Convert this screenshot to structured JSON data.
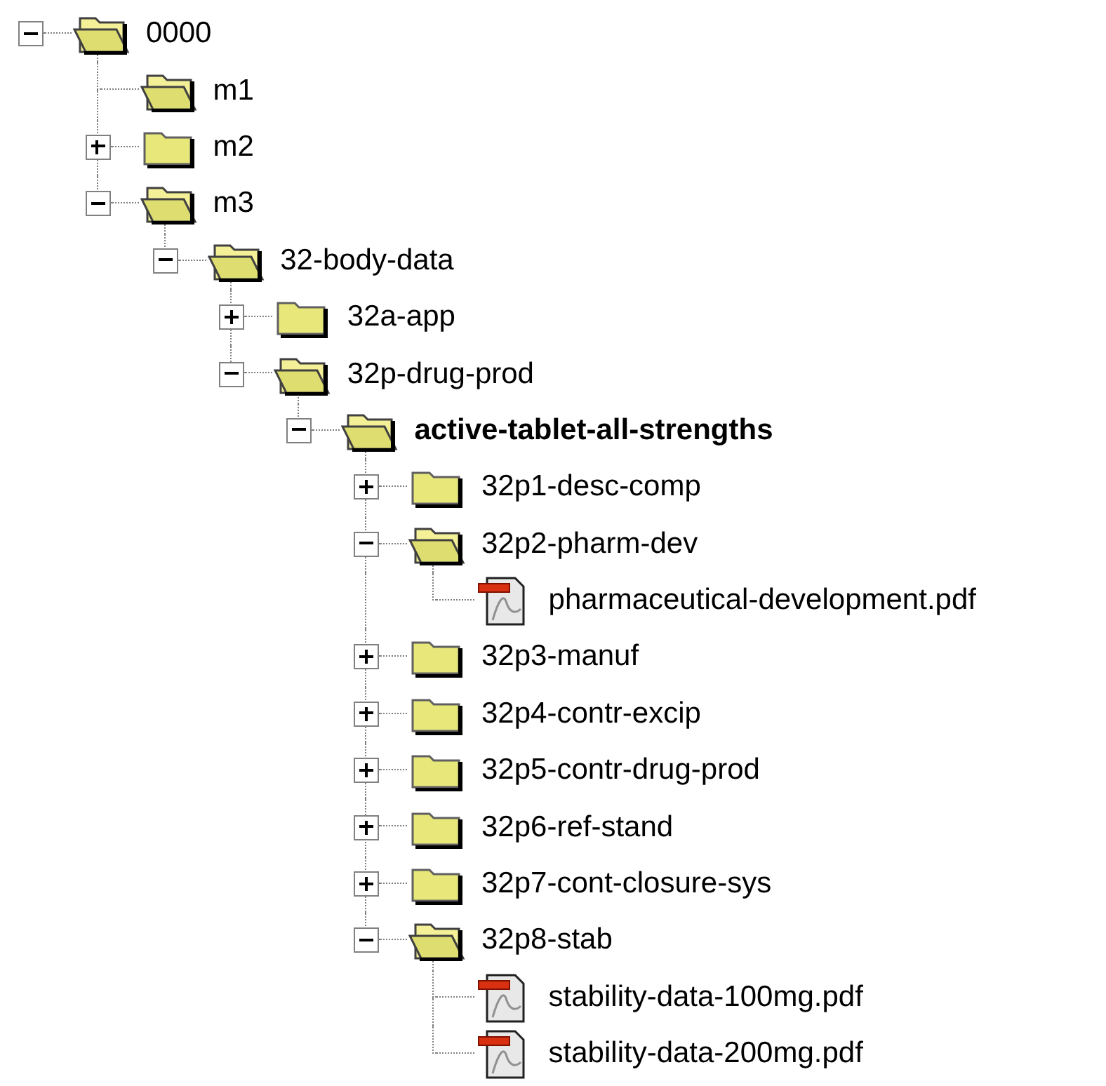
{
  "tree": {
    "nodes": [
      {
        "label": "0000",
        "kind": "folder",
        "expanded": true,
        "bold": false,
        "children": [
          {
            "label": "m1",
            "kind": "folder",
            "expanded": true,
            "bold": false
          },
          {
            "label": "m2",
            "kind": "folder",
            "expanded": false,
            "bold": false
          },
          {
            "label": "m3",
            "kind": "folder",
            "expanded": true,
            "bold": false,
            "children": [
              {
                "label": "32-body-data",
                "kind": "folder",
                "expanded": true,
                "bold": false,
                "children": [
                  {
                    "label": "32a-app",
                    "kind": "folder",
                    "expanded": false,
                    "bold": false
                  },
                  {
                    "label": "32p-drug-prod",
                    "kind": "folder",
                    "expanded": true,
                    "bold": false,
                    "children": [
                      {
                        "label": "active-tablet-all-strengths",
                        "kind": "folder",
                        "expanded": true,
                        "bold": true,
                        "children": [
                          {
                            "label": "32p1-desc-comp",
                            "kind": "folder",
                            "expanded": false,
                            "bold": false
                          },
                          {
                            "label": "32p2-pharm-dev",
                            "kind": "folder",
                            "expanded": true,
                            "bold": false,
                            "children": [
                              {
                                "label": "pharmaceutical-development.pdf",
                                "kind": "file",
                                "bold": false
                              }
                            ]
                          },
                          {
                            "label": "32p3-manuf",
                            "kind": "folder",
                            "expanded": false,
                            "bold": false
                          },
                          {
                            "label": "32p4-contr-excip",
                            "kind": "folder",
                            "expanded": false,
                            "bold": false
                          },
                          {
                            "label": "32p5-contr-drug-prod",
                            "kind": "folder",
                            "expanded": false,
                            "bold": false
                          },
                          {
                            "label": "32p6-ref-stand",
                            "kind": "folder",
                            "expanded": false,
                            "bold": false
                          },
                          {
                            "label": "32p7-cont-closure-sys",
                            "kind": "folder",
                            "expanded": false,
                            "bold": false
                          },
                          {
                            "label": "32p8-stab",
                            "kind": "folder",
                            "expanded": true,
                            "bold": false,
                            "children": [
                              {
                                "label": "stability-data-100mg.pdf",
                                "kind": "file",
                                "bold": false
                              },
                              {
                                "label": "stability-data-200mg.pdf",
                                "kind": "file",
                                "bold": false
                              }
                            ]
                          }
                        ]
                      }
                    ]
                  }
                ]
              }
            ]
          }
        ]
      }
    ]
  }
}
